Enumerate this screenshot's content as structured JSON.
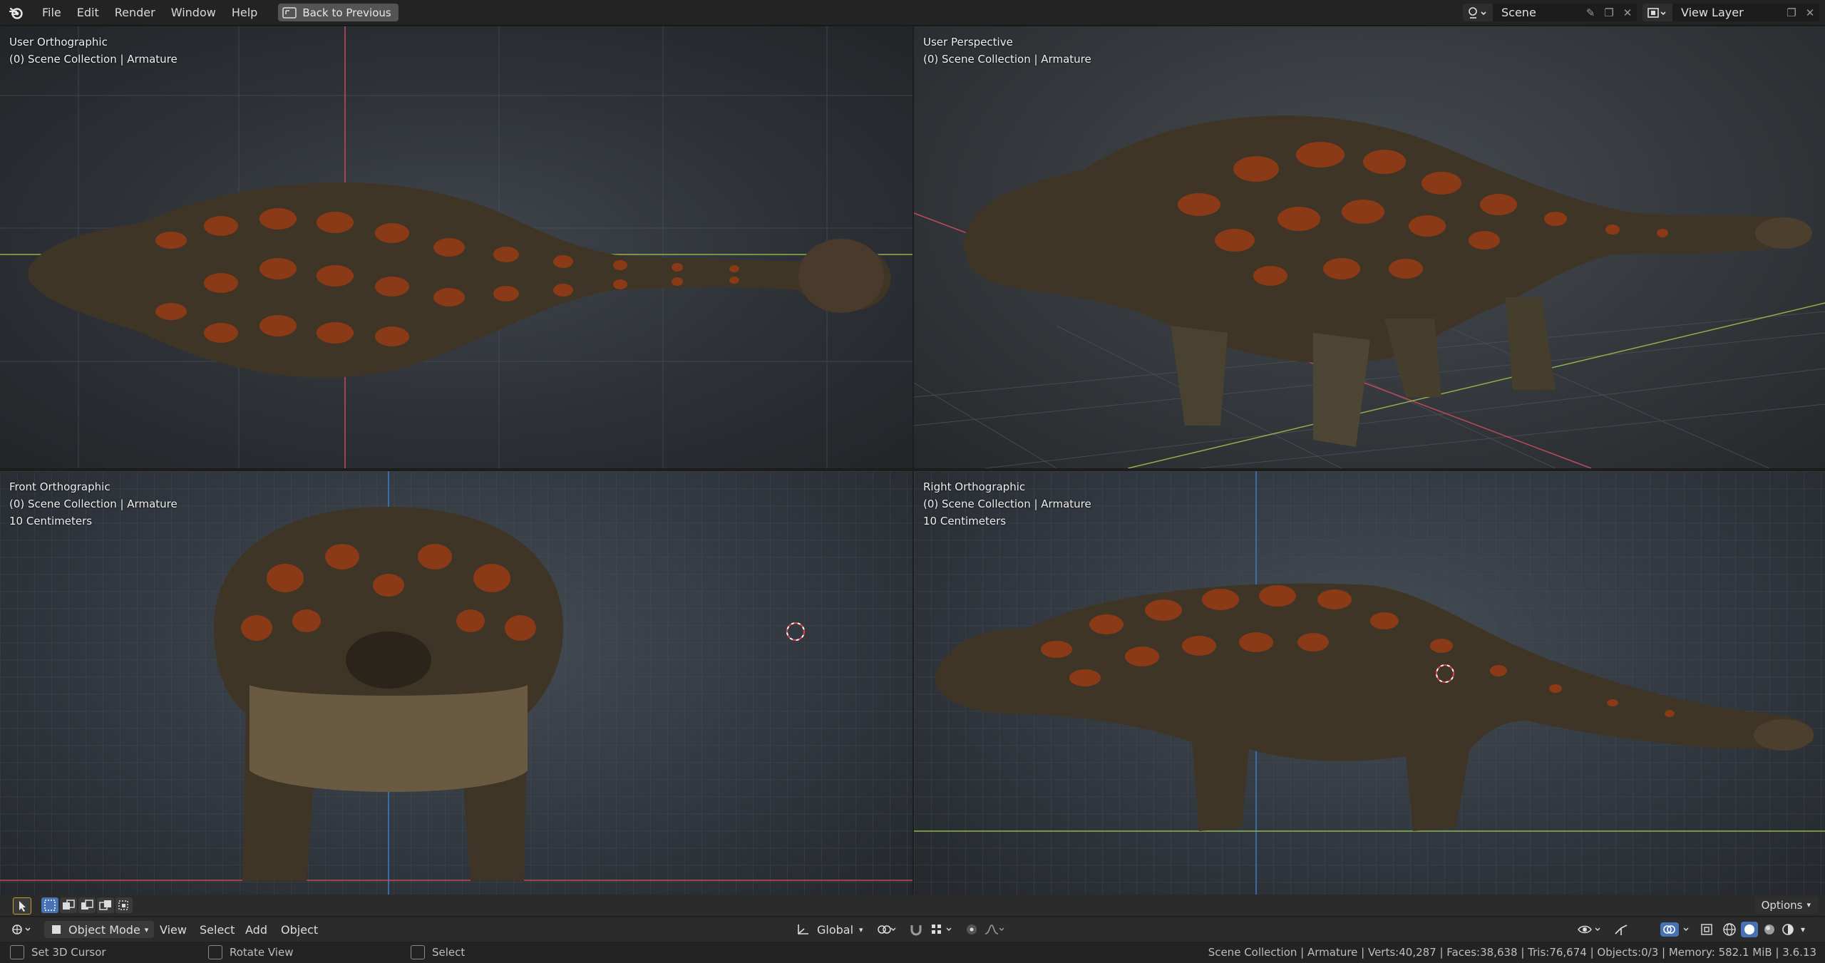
{
  "app": {
    "logo": "blender-logo"
  },
  "menu": [
    "File",
    "Edit",
    "Render",
    "Window",
    "Help"
  ],
  "back_button": "Back to Previous",
  "scene": {
    "label": "Scene",
    "icon": "scene-icon"
  },
  "view_layer": {
    "label": "View Layer",
    "icon": "view-layer-icon"
  },
  "viewports": {
    "top_left": {
      "view": "User Orthographic",
      "collection": "(0) Scene Collection | Armature"
    },
    "top_right": {
      "view": "User Perspective",
      "collection": "(0) Scene Collection | Armature"
    },
    "bottom_left": {
      "view": "Front Orthographic",
      "collection": "(0) Scene Collection | Armature",
      "scale": "10 Centimeters"
    },
    "bottom_right": {
      "view": "Right Orthographic",
      "collection": "(0) Scene Collection | Armature",
      "scale": "10 Centimeters"
    }
  },
  "toolbar": {
    "options": "Options"
  },
  "header": {
    "mode": "Object Mode",
    "view": "View",
    "select": "Select",
    "add": "Add",
    "object": "Object",
    "orientation": "Global"
  },
  "status": {
    "left_click": "Set 3D Cursor",
    "middle_click": "Rotate View",
    "right_click": "Select",
    "stats": "Scene Collection | Armature | Verts:40,287 | Faces:38,638 | Tris:76,674 | Objects:0/3 | Memory: 582.1 MiB | 3.6.13"
  },
  "colors": {
    "x_axis": "#c44a5a",
    "y_axis": "#8fb34a",
    "z_axis": "#3f7cc4",
    "body": "#4a4030",
    "plate": "#b04a1c",
    "accent": "#4772b3"
  }
}
